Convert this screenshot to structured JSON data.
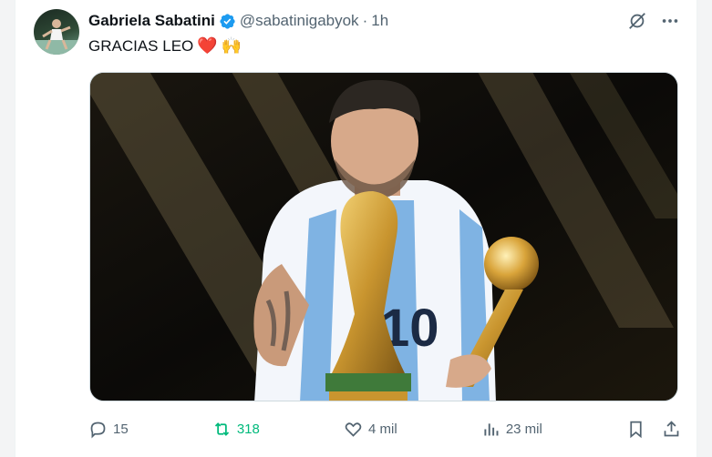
{
  "tweet": {
    "author_name": "Gabriela Sabatini",
    "handle": "@sabatinigabyok",
    "separator": "·",
    "time": "1h",
    "text": "GRACIAS LEO",
    "emoji_heart": "❤️",
    "emoji_hands": "🙌"
  },
  "actions": {
    "replies": "15",
    "retweets": "318",
    "likes": "4 mil",
    "views": "23 mil"
  },
  "colors": {
    "verified": "#1d9bf0",
    "retweet": "#00ba7c",
    "muted": "#536471"
  },
  "icons": {
    "top": [
      "grok-icon",
      "more-icon"
    ],
    "actions": [
      "reply-icon",
      "retweet-icon",
      "like-icon",
      "views-icon",
      "bookmark-icon",
      "share-icon"
    ]
  }
}
